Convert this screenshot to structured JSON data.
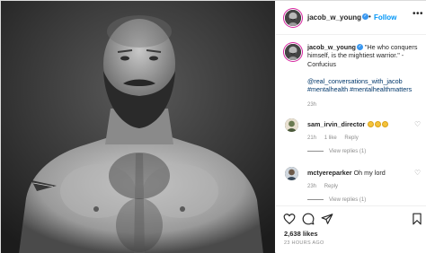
{
  "post": {
    "username": "jacob_w_young",
    "dot": "•",
    "follow_label": "Follow",
    "more_icon": "more-dots-icon",
    "verified_glyph": "✓"
  },
  "caption": {
    "username": "jacob_w_young",
    "text": "\"He who conquers himself, is the mightiest warrior.\" - Confucius",
    "tags": [
      "@real_conversations_with_jacob",
      "#mentalhealth",
      "#mentalhealthmatters"
    ],
    "time": "23h"
  },
  "comments": [
    {
      "username": "sam_irvin_director",
      "text": "",
      "emoji_count": 3,
      "time": "21h",
      "likes": "1 like",
      "reply": "Reply",
      "view_replies": "View replies (1)"
    },
    {
      "username": "mctyereparker",
      "text": "Oh my lord",
      "time": "23h",
      "reply": "Reply",
      "view_replies": "View replies (1)"
    }
  ],
  "footer": {
    "likes": "2,638 likes",
    "timeago": "23 HOURS AGO"
  },
  "colors": {
    "accent": "#0095f6",
    "verified": "#3897f0",
    "link": "#00376b",
    "muted": "#8e8e8e"
  }
}
